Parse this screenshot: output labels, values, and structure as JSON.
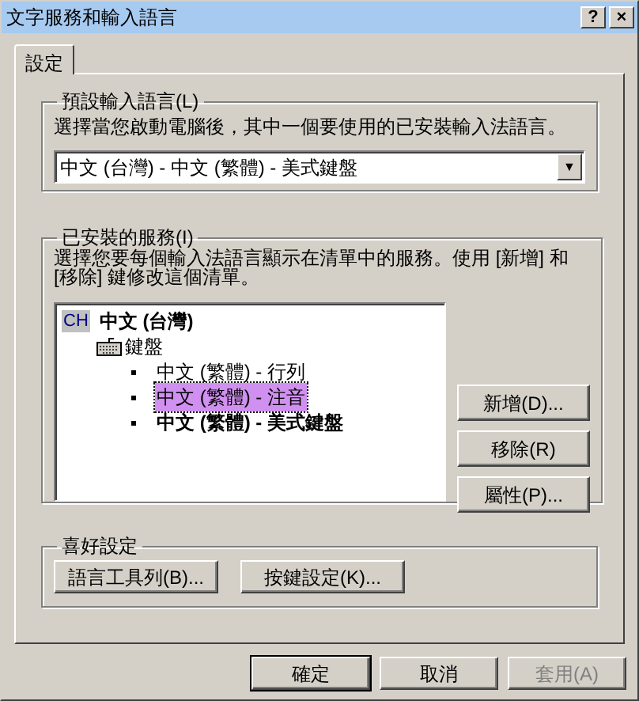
{
  "window": {
    "title": "文字服務和輸入語言",
    "title_buttons": [
      "?",
      "×"
    ]
  },
  "tabs": [
    {
      "label": "設定",
      "selected": true
    }
  ],
  "default_language": {
    "title": "預設輸入語言(L)",
    "description": "選擇當您啟動電腦後，其中一個要使用的已安裝輸入法語言。",
    "value": "中文 (台灣) - 中文 (繁體) - 美式鍵盤",
    "arrow": "▼"
  },
  "installed_services": {
    "title": "已安裝的服務(I)",
    "description": "選擇您要每個輸入法語言顯示在清單中的服務。使用 [新增] 和 [移除] 鍵修改這個清單。",
    "tree": [
      {
        "kind": "language",
        "badge": "CH",
        "label": "中文 (台灣)",
        "children": [
          {
            "kind": "keyboard",
            "label": "鍵盤",
            "children": [
              {
                "kind": "service",
                "label": "中文 (繁體) - 行列",
                "selected": false,
                "default": false
              },
              {
                "kind": "service",
                "label": "中文 (繁體) - 注音",
                "selected": true,
                "default": false
              },
              {
                "kind": "service",
                "label": "中文 (繁體) - 美式鍵盤",
                "selected": false,
                "default": true
              }
            ]
          }
        ]
      }
    ],
    "buttons": [
      {
        "label": "新增(D)..."
      },
      {
        "label": "移除(R)"
      },
      {
        "label": "屬性(P)..."
      }
    ]
  },
  "preferences": {
    "title": "喜好設定",
    "buttons": [
      {
        "label": "語言工具列(B)..."
      },
      {
        "label": "按鍵設定(K)..."
      }
    ]
  },
  "dialog_buttons": [
    {
      "label": "確定",
      "default": true,
      "disabled": false
    },
    {
      "label": "取消",
      "default": false,
      "disabled": false
    },
    {
      "label": "套用(A)",
      "default": false,
      "disabled": true
    }
  ]
}
